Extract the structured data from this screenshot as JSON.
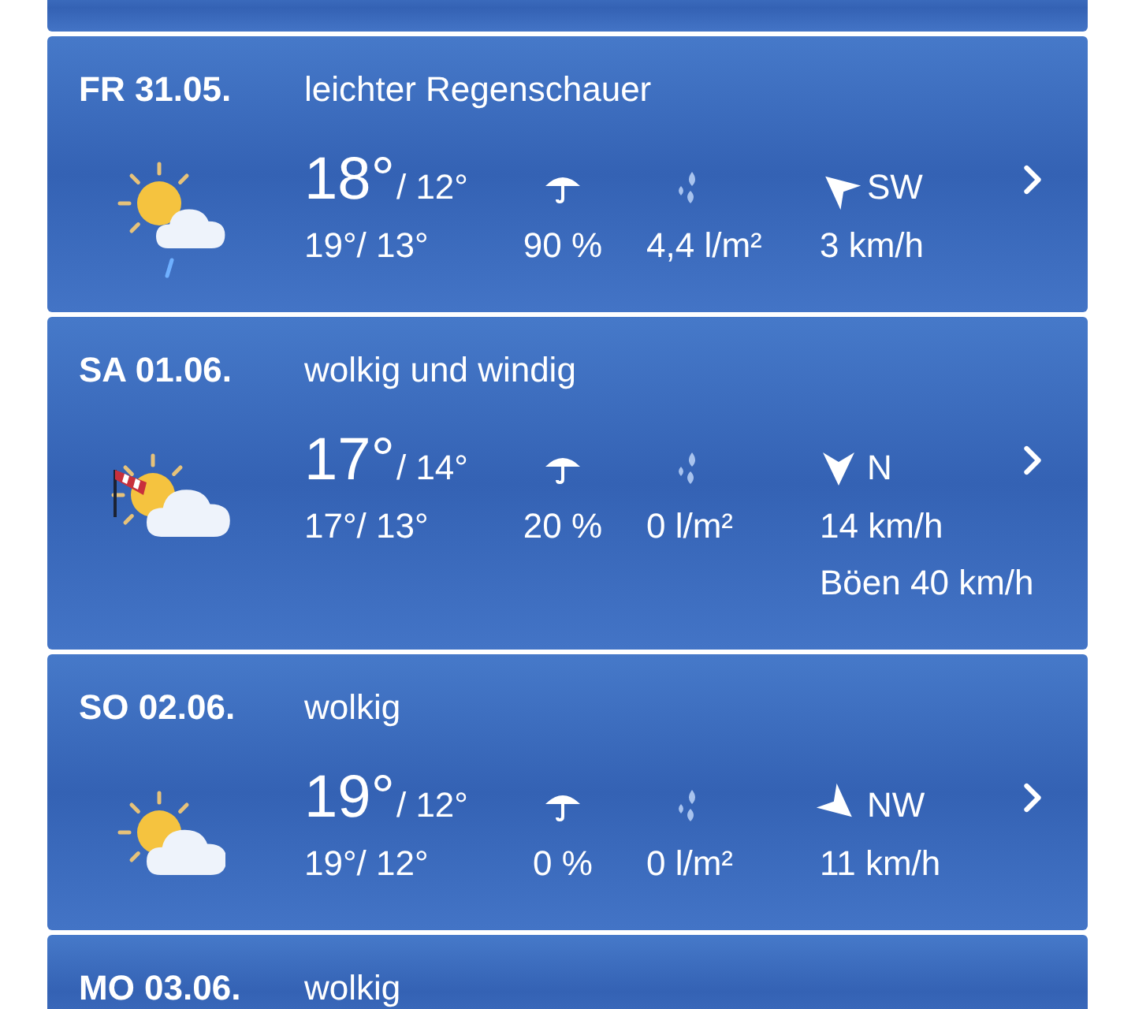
{
  "days": [
    {
      "date": "FR 31.05.",
      "description": "leichter Regenschauer",
      "weather_icon": {
        "kind": "sun-cloud-rain"
      },
      "high": "18°",
      "low": "/ 12°",
      "feels": "19°/ 13°",
      "rain_chance": "90 %",
      "rain_amount": "4,4 l/m²",
      "wind_dir": "SW",
      "wind_arrow": {
        "kind": "up-left"
      },
      "wind_speed": "3 km/h"
    },
    {
      "date": "SA 01.06.",
      "description": "wolkig und windig",
      "weather_icon": {
        "kind": "sun-cloud-windsock"
      },
      "high": "17°",
      "low": "/ 14°",
      "feels": "17°/ 13°",
      "rain_chance": "20 %",
      "rain_amount": "0 l/m²",
      "wind_dir": "N",
      "wind_arrow": {
        "kind": "down"
      },
      "wind_speed": "14 km/h",
      "gusts": "Böen 40 km/h"
    },
    {
      "date": "SO 02.06.",
      "description": "wolkig",
      "weather_icon": {
        "kind": "sun-cloud"
      },
      "high": "19°",
      "low": "/ 12°",
      "feels": "19°/ 12°",
      "rain_chance": "0 %",
      "rain_amount": "0 l/m²",
      "wind_dir": "NW",
      "wind_arrow": {
        "kind": "down-right"
      },
      "wind_speed": "11 km/h"
    },
    {
      "date": "MO 03.06.",
      "description": "wolkig"
    }
  ]
}
